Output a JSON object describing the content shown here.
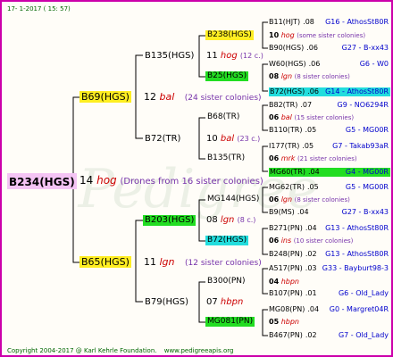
{
  "header": {
    "date": "17-  1-2017 ( 15: 57)"
  },
  "footer": {
    "copyright": "Copyright 2004-2017 @ Karl Kehrle Foundation.",
    "site": "www.pedigreeapis.org"
  },
  "colors": {
    "frame": "#cc00aa",
    "yellow": "#ffee22",
    "green": "#22dd22",
    "cyan": "#22dddd",
    "red": "#cc0000",
    "blue": "#0000cc",
    "purple": "#7733aa",
    "dkgreen": "#006600"
  },
  "root": {
    "name": "B234(HGS)",
    "gen": "14",
    "tag": "hog",
    "note": "(Drones from 16 sister colonies)"
  },
  "g1": {
    "top": {
      "name": "B69(HGS)",
      "gen": "12",
      "tag": "bal",
      "note": "(24 sister colonies)"
    },
    "bot": {
      "name": "B65(HGS)",
      "gen": "11",
      "tag": "lgn",
      "note": "(12 sister colonies)"
    }
  },
  "g2": {
    "a": {
      "name": "B135(HGS)",
      "gen": "11",
      "tag": "hog",
      "note": "(12 c.)"
    },
    "b": {
      "name": "B72(TR)",
      "gen": "10",
      "tag": "bal",
      "note": "(23 c.)"
    },
    "c": {
      "name": "B203(HGS)",
      "gen": "08",
      "tag": "lgn",
      "note": "(8 c.)"
    },
    "d": {
      "name": "B79(HGS)",
      "gen": "07",
      "tag": "hbpn",
      "note": ""
    }
  },
  "g3": {
    "a1": {
      "name": "B238(HGS)",
      "gen": "10",
      "tag": "hog",
      "note": "(some sister colonies)"
    },
    "a2": {
      "name": "B25(HGS)",
      "gen": "08",
      "tag": "lgn",
      "note": "(8 sister colonies)"
    },
    "b1": {
      "name": "B68(TR)",
      "gen": "06",
      "tag": "bal",
      "note": "(15 sister colonies)"
    },
    "b2": {
      "name": "B135(TR)",
      "gen": "06",
      "tag": "mrk",
      "note": "(21 sister colonies)"
    },
    "c1": {
      "name": "MG144(HGS)",
      "gen": "06",
      "tag": "lgn",
      "note": "(8 sister colonies)"
    },
    "c2": {
      "name": "B72(HGS)",
      "gen": "06",
      "tag": "ins",
      "note": "(10 sister colonies)"
    },
    "d1": {
      "name": "B300(PN)",
      "gen": "04",
      "tag": "hbpn",
      "note": ""
    },
    "d2": {
      "name": "MG081(PN)",
      "gen": "05",
      "tag": "hbpn",
      "note": ""
    }
  },
  "g4": [
    {
      "name": "B11(HJT)",
      "yr": ".08",
      "gen": "G16 - AthosSt80R"
    },
    {
      "name": "B90(HGS)",
      "yr": ".06",
      "gen": "G27 - B-xx43"
    },
    {
      "name": "W60(HGS)",
      "yr": ".06",
      "gen": "G6 - W0"
    },
    {
      "name": "B72(HGS)",
      "yr": ".06",
      "gen": "G14 - AthosSt80R"
    },
    {
      "name": "B82(TR)",
      "yr": ".07",
      "gen": "G9 - NO6294R"
    },
    {
      "name": "B110(TR)",
      "yr": ".05",
      "gen": "G5 - MG00R"
    },
    {
      "name": "I177(TR)",
      "yr": ".05",
      "gen": "G7 - Takab93aR"
    },
    {
      "name": "MG60(TR)",
      "yr": ".04",
      "gen": "G4 - MG00R"
    },
    {
      "name": "MG62(TR)",
      "yr": ".05",
      "gen": "G5 - MG00R"
    },
    {
      "name": "B9(MS)",
      "yr": ".04",
      "gen": "G27 - B-xx43"
    },
    {
      "name": "B271(PN)",
      "yr": ".04",
      "gen": "G13 - AthosSt80R"
    },
    {
      "name": "B248(PN)",
      "yr": ".02",
      "gen": "G13 - AthosSt80R"
    },
    {
      "name": "A517(PN)",
      "yr": ".03",
      "gen": "G33 - Bayburt98-3"
    },
    {
      "name": "B107(PN)",
      "yr": ".01",
      "gen": "G6 - Old_Lady"
    },
    {
      "name": "MG08(PN)",
      "yr": ".04",
      "gen": "G0 - Margret04R"
    },
    {
      "name": "B467(PN)",
      "yr": ".02",
      "gen": "G7 - Old_Lady"
    }
  ]
}
